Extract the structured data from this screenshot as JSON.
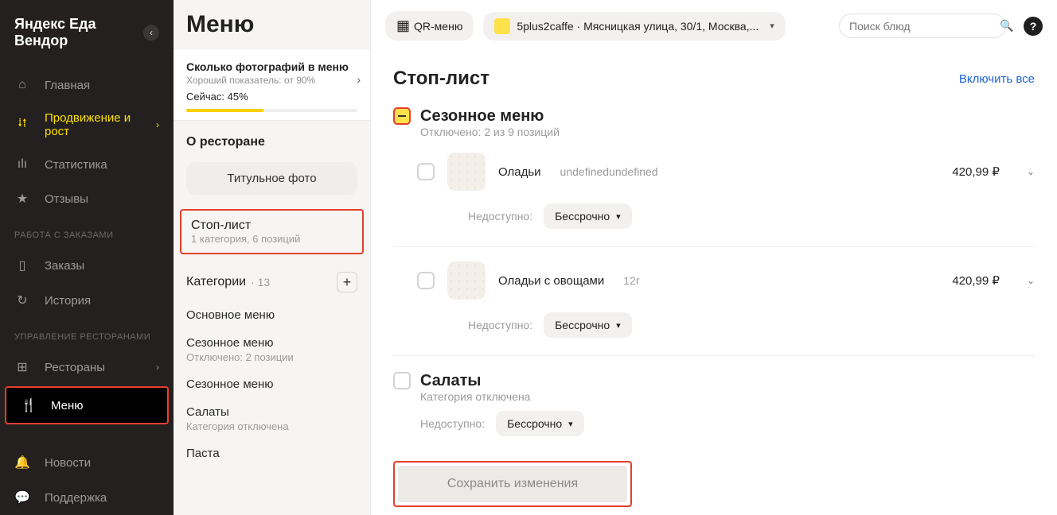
{
  "app_title": "Яндекс Еда Вендор",
  "sidebar": {
    "items": [
      {
        "icon": "home-icon",
        "glyph": "⌂",
        "label": "Главная"
      },
      {
        "icon": "growth-icon",
        "glyph": "⭭⭫",
        "label": "Продвижение и рост",
        "chev": "›"
      },
      {
        "icon": "stats-icon",
        "glyph": "ılı",
        "label": "Статистика"
      },
      {
        "icon": "reviews-icon",
        "glyph": "★",
        "label": "Отзывы"
      }
    ],
    "group_orders_title": "РАБОТА С ЗАКАЗАМИ",
    "orders": [
      {
        "icon": "orders-icon",
        "glyph": "▯",
        "label": "Заказы"
      },
      {
        "icon": "history-icon",
        "glyph": "↻",
        "label": "История"
      }
    ],
    "group_manage_title": "УПРАВЛЕНИЕ РЕСТОРАНАМИ",
    "manage": [
      {
        "icon": "restaurants-icon",
        "glyph": "⊞",
        "label": "Рестораны",
        "chev": "›"
      },
      {
        "icon": "menu-icon",
        "glyph": "🍴",
        "label": "Меню"
      }
    ],
    "bottom": [
      {
        "icon": "bell-icon",
        "glyph": "🔔",
        "label": "Новости"
      },
      {
        "icon": "support-icon",
        "glyph": "💬",
        "label": "Поддержка"
      }
    ]
  },
  "panel": {
    "heading": "Меню",
    "photos": {
      "title": "Сколько фотографий в меню",
      "sub": "Хороший показатель: от 90%",
      "now": "Сейчас: 45%"
    },
    "about_title": "О ресторане",
    "title_photo_btn": "Титульное фото",
    "stoplist": {
      "title": "Стоп-лист",
      "sub": "1 категория, 6 позиций"
    },
    "categories_label": "Категории",
    "categories_count": "· 13",
    "cats": [
      {
        "title": "Основное меню",
        "sub": ""
      },
      {
        "title": "Сезонное меню",
        "sub": "Отключено: 2 позиции"
      },
      {
        "title": "Сезонное меню",
        "sub": ""
      },
      {
        "title": "Салаты",
        "sub": "Категория отключена"
      },
      {
        "title": "Паста",
        "sub": ""
      }
    ]
  },
  "topbar": {
    "qr_label": "QR-меню",
    "restaurant": "5plus2caffe · Мясницкая улица, 30/1, Москва,...",
    "search_placeholder": "Поиск блюд"
  },
  "content": {
    "title": "Стоп-лист",
    "enable_all": "Включить все",
    "avail_label": "Недоступно:",
    "term_label": "Бессрочно",
    "save_label": "Сохранить изменения",
    "groups": [
      {
        "title": "Сезонное меню",
        "sub": "Отключено: 2 из 9 позиций",
        "check_state": "minus",
        "dishes": [
          {
            "name": "Оладьи",
            "note": "undefinedundefined",
            "price": "420,99 ₽"
          },
          {
            "name": "Оладьи с овощами",
            "note": "12г",
            "price": "420,99 ₽"
          }
        ]
      },
      {
        "title": "Салаты",
        "sub": "Категория отключена",
        "check_state": "empty"
      }
    ]
  }
}
